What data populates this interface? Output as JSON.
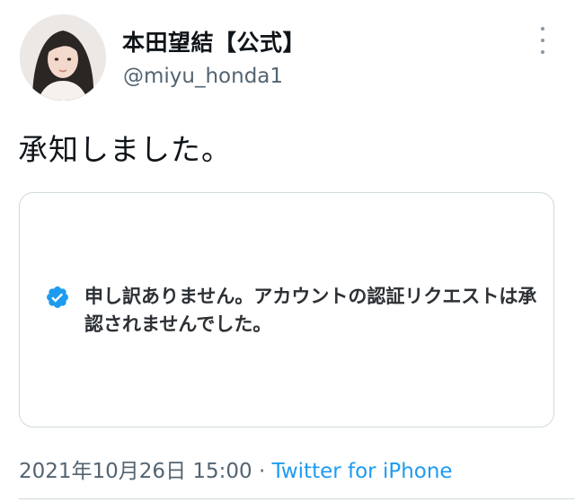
{
  "author": {
    "display_name": "本田望結【公式】",
    "handle": "@miyu_honda1",
    "avatar_icon": "profile-photo"
  },
  "tweet": {
    "text": "承知しました。"
  },
  "card": {
    "badge_icon": "verified-badge-icon",
    "badge_color": "#1d9bf0",
    "message": "申し訳ありません。アカウントの認証リクエストは承認されませんでした。"
  },
  "meta": {
    "timestamp": "2021年10月26日 15:00",
    "separator": " · ",
    "source": "Twitter for iPhone"
  }
}
